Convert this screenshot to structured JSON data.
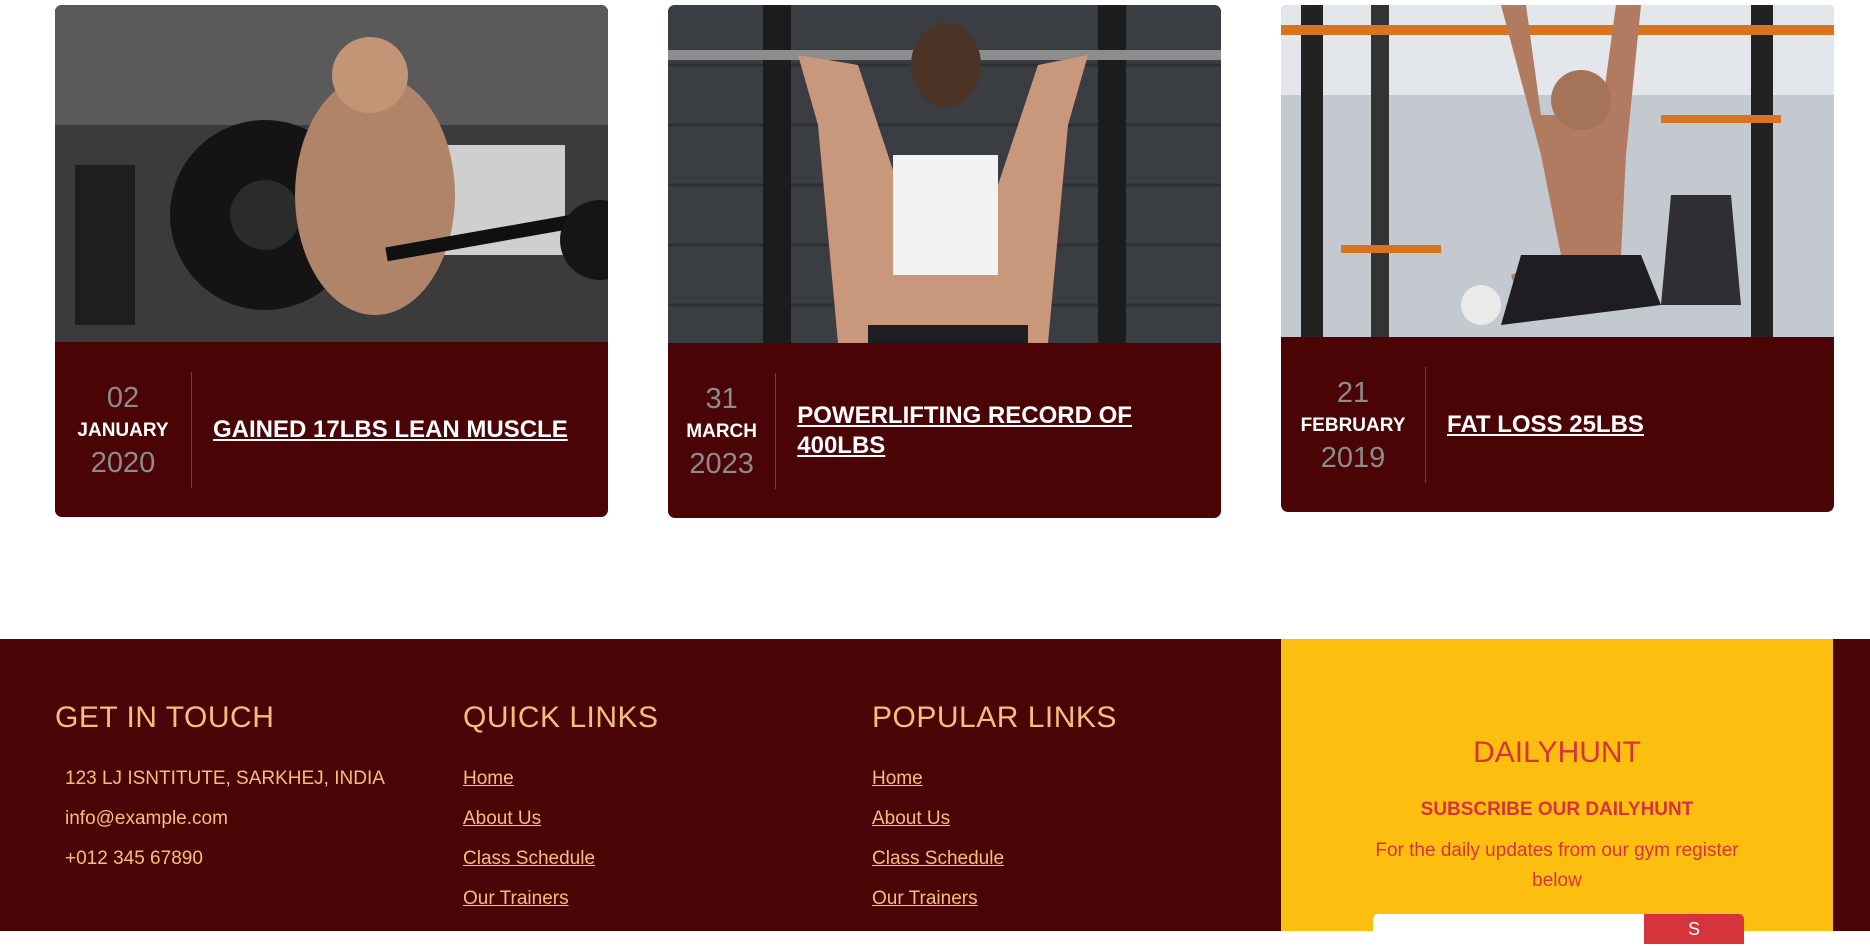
{
  "blog": {
    "cards": [
      {
        "day": "02",
        "month": "JANUARY",
        "year": "2020",
        "title": "GAINED 17LBS LEAN MUSCLE"
      },
      {
        "day": "31",
        "month": "MARCH",
        "year": "2023",
        "title": "POWERLIFTING RECORD OF 400LBS"
      },
      {
        "day": "21",
        "month": "FEBRUARY",
        "year": "2019",
        "title": "FAT LOSS 25LBS"
      }
    ]
  },
  "footer": {
    "contact": {
      "heading": "GET IN TOUCH",
      "address": "123 LJ ISNTITUTE, SARKHEJ, INDIA",
      "email": "info@example.com",
      "phone": "+012 345 67890"
    },
    "quick_links": {
      "heading": "QUICK LINKS",
      "items": [
        "Home",
        "About Us",
        "Class Schedule",
        "Our Trainers"
      ]
    },
    "popular_links": {
      "heading": "POPULAR LINKS",
      "items": [
        "Home",
        "About Us",
        "Class Schedule",
        "Our Trainers"
      ]
    },
    "newsletter": {
      "heading": "DAILYHUNT",
      "subheading": "SUBSCRIBE OUR DAILYHUNT",
      "description": "For the daily updates from our gym register below",
      "email_placeholder": "",
      "button_label": "S"
    }
  },
  "colors": {
    "maroon": "#4a0406",
    "gold_text": "#f1c07a",
    "yellow": "#fdbf0f",
    "red_accent": "#d6343c"
  }
}
